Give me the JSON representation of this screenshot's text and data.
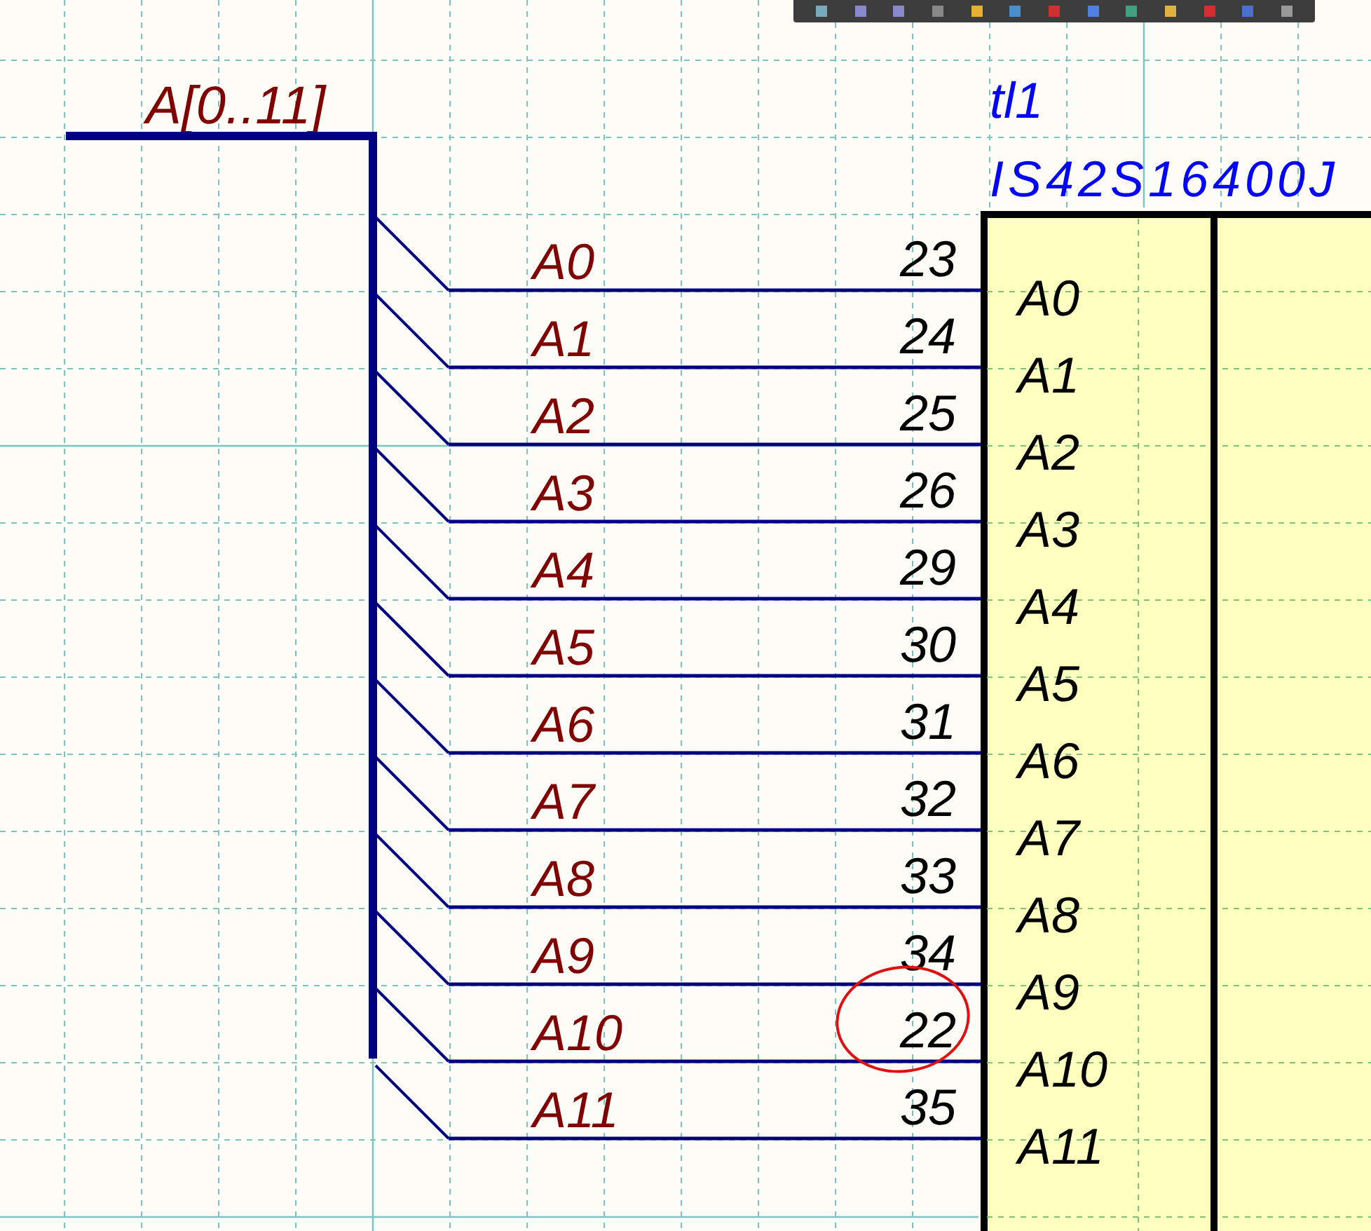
{
  "bus": {
    "label": "A[0..11]"
  },
  "component": {
    "designator": "tl1",
    "part": "IS42S16400J"
  },
  "pins": [
    {
      "net": "A0",
      "number": "23",
      "name": "A0",
      "marked": false
    },
    {
      "net": "A1",
      "number": "24",
      "name": "A1",
      "marked": false
    },
    {
      "net": "A2",
      "number": "25",
      "name": "A2",
      "marked": false
    },
    {
      "net": "A3",
      "number": "26",
      "name": "A3",
      "marked": false
    },
    {
      "net": "A4",
      "number": "29",
      "name": "A4",
      "marked": false
    },
    {
      "net": "A5",
      "number": "30",
      "name": "A5",
      "marked": false
    },
    {
      "net": "A6",
      "number": "31",
      "name": "A6",
      "marked": false
    },
    {
      "net": "A7",
      "number": "32",
      "name": "A7",
      "marked": false
    },
    {
      "net": "A8",
      "number": "33",
      "name": "A8",
      "marked": false
    },
    {
      "net": "A9",
      "number": "34",
      "name": "A9",
      "marked": false
    },
    {
      "net": "A10",
      "number": "22",
      "name": "A10",
      "marked": true
    },
    {
      "net": "A11",
      "number": "35",
      "name": "A11",
      "marked": false
    }
  ]
}
